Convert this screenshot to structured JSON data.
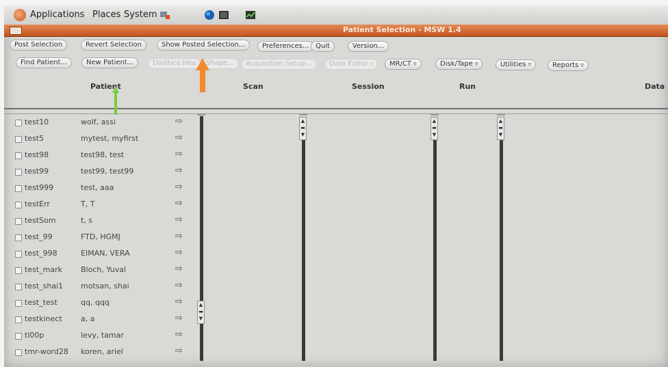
{
  "panel": {
    "applications": "Applications",
    "places": "Places",
    "system": "System"
  },
  "window": {
    "title": "Patient Selection - MSW 1.4"
  },
  "toolbar1": [
    "Post Selection",
    "Revert Selection",
    "Show Posted Selection...",
    "Preferences...",
    "Quit",
    "Version..."
  ],
  "toolbar2": {
    "find_patient": "Find Patient...",
    "new_patient": "New Patient...",
    "disabled1": "Diolitica Hea",
    "disabled2": "Shape...",
    "disabled3": "Acquisition Setup...",
    "disabled4": "Data Editor",
    "mrct": "MR/CT",
    "disktape": "Disk/Tape",
    "utilities": "Utilities",
    "reports": "Reports"
  },
  "columns": {
    "patient": "Patient",
    "scan": "Scan",
    "session": "Session",
    "run": "Run",
    "data": "Data"
  },
  "patients": [
    {
      "id": "test10",
      "name": "wolf, assi"
    },
    {
      "id": "test5",
      "name": "mytest, myfirst"
    },
    {
      "id": "test98",
      "name": "test98, test"
    },
    {
      "id": "test99",
      "name": "test99, test99"
    },
    {
      "id": "test999",
      "name": "test, aaa"
    },
    {
      "id": "testErr",
      "name": "T, T"
    },
    {
      "id": "testSom",
      "name": "t, s"
    },
    {
      "id": "test_99",
      "name": "FTD, HGMJ"
    },
    {
      "id": "test_998",
      "name": "EIMAN, VERA"
    },
    {
      "id": "test_mark",
      "name": "Bloch, Yuval"
    },
    {
      "id": "test_shai1",
      "name": "motsan, shai"
    },
    {
      "id": "test_test",
      "name": "qq, qqq"
    },
    {
      "id": "testkinect",
      "name": "a, a"
    },
    {
      "id": "tl00p",
      "name": "levy, tamar"
    },
    {
      "id": "tmr-word28",
      "name": "koren, ariel"
    }
  ],
  "colors": {
    "titlebar": "#c2541f",
    "annotation_orange": "#f28a2f",
    "annotation_green": "#7ecb3c"
  }
}
